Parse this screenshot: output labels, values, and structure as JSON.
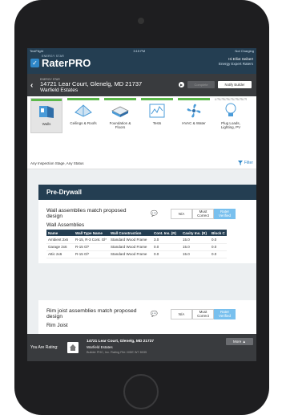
{
  "status_bar": {
    "carrier": "TestFlight",
    "time": "3:15 PM",
    "battery": "Not Charging"
  },
  "app": {
    "program": "ENERGY STAR",
    "name": "RaterPRO"
  },
  "user": {
    "greeting": "Hi Elliot Seibert",
    "role": "Energy Expert Raters"
  },
  "project": {
    "program": "ENERGY STAR",
    "address": "14721 Lear Court, Glenelg, MD 21737",
    "community": "Warfield Estates",
    "complete_label": "Complete",
    "notify_label": "Notify Builder"
  },
  "categories": [
    {
      "label": "Walls",
      "icon": "walls-icon"
    },
    {
      "label": "Ceilings & Roofs",
      "icon": "roof-icon"
    },
    {
      "label": "Foundation & Floors",
      "icon": "foundation-icon"
    },
    {
      "label": "Tests",
      "icon": "tests-icon"
    },
    {
      "label": "HVAC & Water",
      "icon": "fan-icon"
    },
    {
      "label": "Plug Loads, Lighting, PV",
      "icon": "bulb-icon"
    }
  ],
  "filter": {
    "stage": "Any Inspection Stage, Any Status",
    "label": "Filter"
  },
  "stage_title": "Pre-Drywall",
  "questions": [
    {
      "text": "Wall assemblies match proposed design",
      "options": [
        "N/A",
        "Must Correct",
        "Rater Verified"
      ],
      "section": "Wall Assemblies",
      "columns": [
        "Name",
        "Wall Type Name",
        "Wall Construction",
        "Cont. Ins. (R)",
        "Cavity Ins. (R)",
        "Block C"
      ],
      "rows": [
        [
          "Ambient 2x6",
          "R-15, R-3 Cont. Gl*",
          "Standard Wood Frame",
          "3.0",
          "15.0",
          "0.0"
        ],
        [
          "Garage 2x6",
          "R-15 Gl*",
          "Standard Wood Frame",
          "0.0",
          "15.0",
          "0.0"
        ],
        [
          "Attic 2x6",
          "R-15 Gl*",
          "Standard Wood Frame",
          "0.0",
          "15.0",
          "0.0"
        ]
      ]
    },
    {
      "text": "Rim joist assemblies match proposed design",
      "options": [
        "N/A",
        "Must Correct",
        "Rater Verified"
      ],
      "section": "Rim Joist"
    }
  ],
  "footer": {
    "rating_label": "You Are Rating:",
    "address": "14721 Lear Court, Glenelg, MD 21737",
    "community": "Warfield Estates",
    "builder": "Builder PHC, Inc. Rating File: MDE W7 8035",
    "more_label": "More"
  }
}
